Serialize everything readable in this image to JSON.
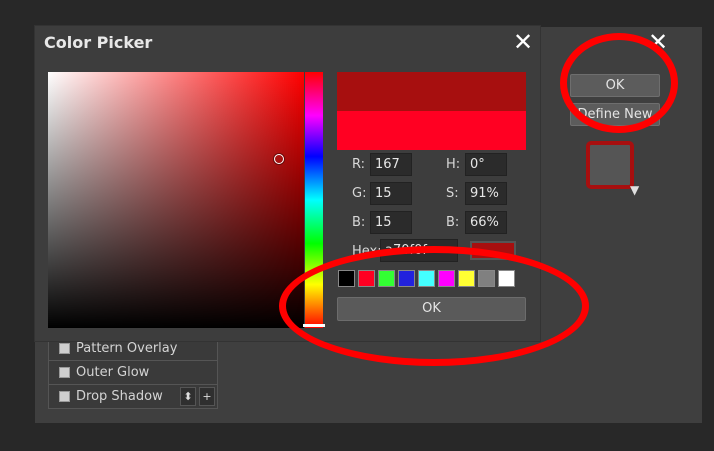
{
  "background_dialog": {
    "ok_label": "OK",
    "define_new_label": "Define New",
    "close_glyph": "✕",
    "style_color": "#a70f0f",
    "swatch_arrow": "▼",
    "layer_styles": [
      {
        "label": "Pattern Overlay"
      },
      {
        "label": "Outer Glow"
      },
      {
        "label": "Drop Shadow"
      }
    ],
    "drop_shadow_buttons": [
      "⬍",
      "+"
    ]
  },
  "color_picker": {
    "title": "Color Picker",
    "close_glyph": "✕",
    "fields": {
      "r_label": "R:",
      "r_value": "167",
      "g_label": "G:",
      "g_value": "15",
      "b_label": "B:",
      "b_value": "15",
      "h_label": "H:",
      "h_value": "0°",
      "s_label": "S:",
      "s_value": "91%",
      "bv_label": "B:",
      "bv_value": "66%",
      "hex_label": "Hex:",
      "hex_value": "a70f0f"
    },
    "new_color": "#a70f0f",
    "old_color": "#ff0022",
    "presets": [
      "#000000",
      "#ff0022",
      "#33ff33",
      "#2222dd",
      "#44ffff",
      "#ff00ff",
      "#ffff33",
      "#808080",
      "#ffffff"
    ],
    "ok_label": "OK"
  },
  "annotations": {
    "color": "#ff0000"
  }
}
